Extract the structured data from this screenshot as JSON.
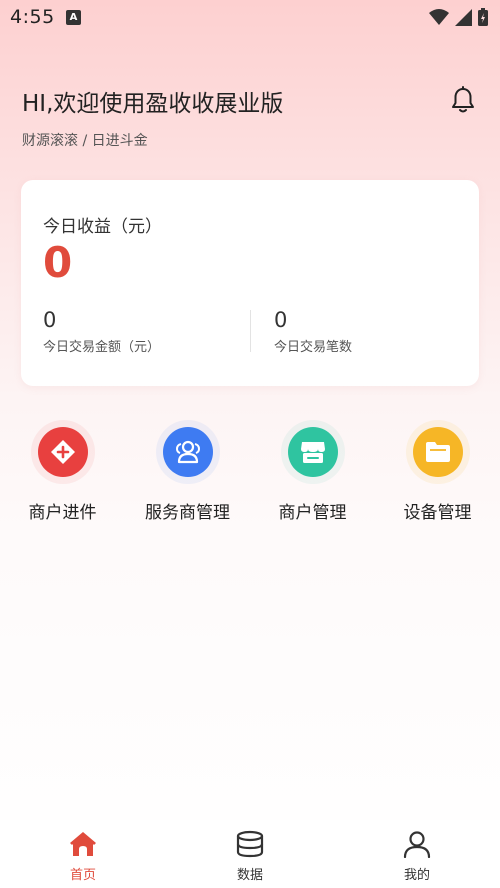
{
  "status_bar": {
    "time": "4:55",
    "notification_badge": "A"
  },
  "header": {
    "greeting": "HI,欢迎使用盈收收展业版",
    "subtitle": "财源滚滚 / 日进斗金",
    "bell_icon": "bell-icon"
  },
  "earnings_card": {
    "label": "今日收益（元）",
    "value": "0",
    "stats": [
      {
        "value": "0",
        "label": "今日交易金额（元）"
      },
      {
        "value": "0",
        "label": "今日交易笔数"
      }
    ]
  },
  "menu": [
    {
      "label": "商户进件",
      "icon": "merchant-onboarding-icon",
      "color": "#e8403f"
    },
    {
      "label": "服务商管理",
      "icon": "users-icon",
      "color": "#3e7bf2"
    },
    {
      "label": "商户管理",
      "icon": "store-icon",
      "color": "#2fc4a0"
    },
    {
      "label": "设备管理",
      "icon": "folder-icon",
      "color": "#f6b626"
    }
  ],
  "bottom_nav": [
    {
      "label": "首页",
      "icon": "home-icon",
      "active": true
    },
    {
      "label": "数据",
      "icon": "database-icon",
      "active": false
    },
    {
      "label": "我的",
      "icon": "user-icon",
      "active": false
    }
  ],
  "colors": {
    "accent": "#e04b3c",
    "background_top": "#fdd0d0"
  }
}
